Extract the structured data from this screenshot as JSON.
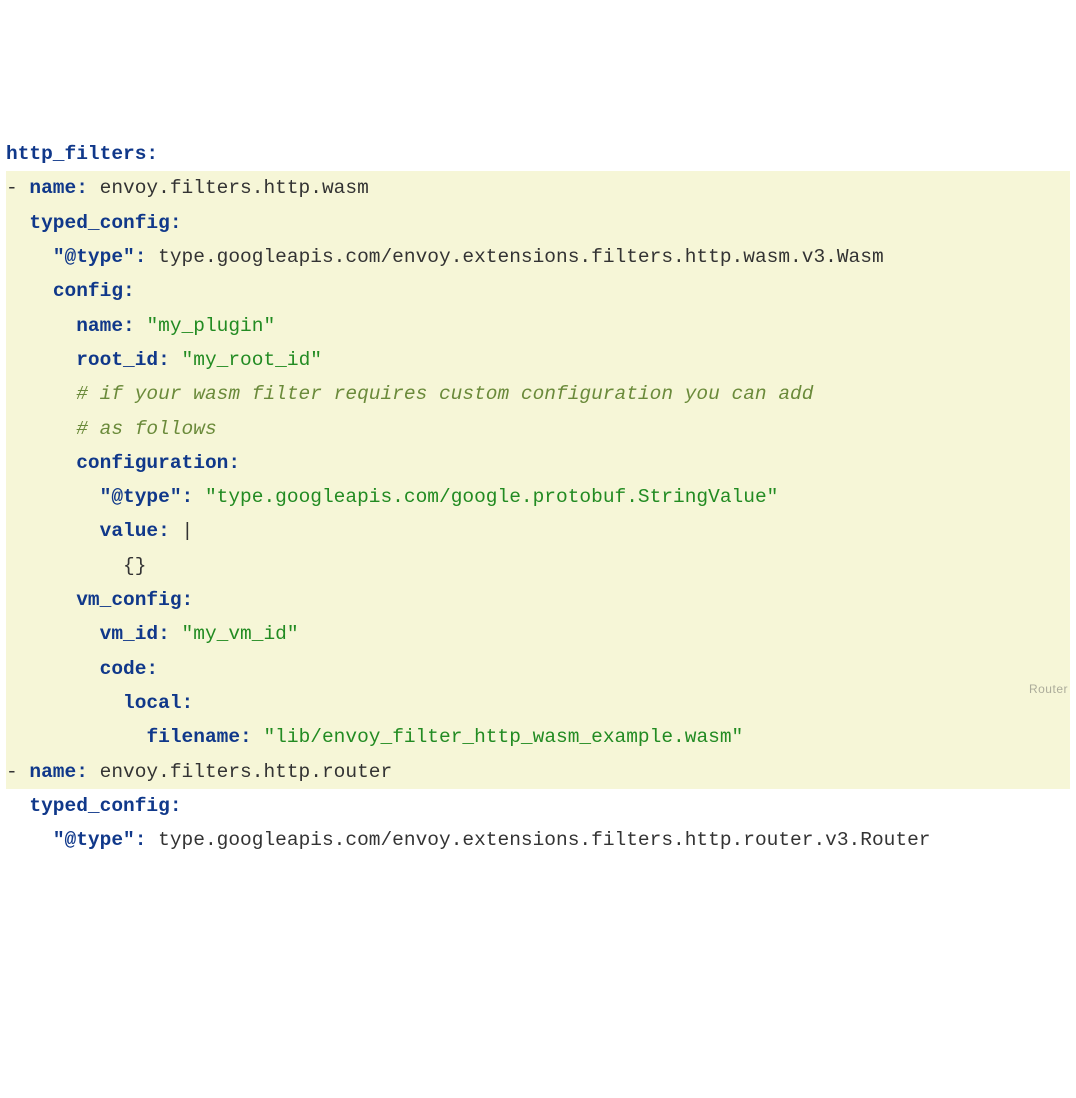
{
  "lines": {
    "l1_key": "http_filters:",
    "l2_dash": "-",
    "l2_key": "name:",
    "l2_val": "envoy.filters.http.wasm",
    "l3_key": "typed_config:",
    "l4_key": "\"@type\":",
    "l4_val": "type.googleapis.com/envoy.extensions.filters.http.wasm.v3.Wasm",
    "l5_key": "config:",
    "l6_key": "name:",
    "l6_val": "\"my_plugin\"",
    "l7_key": "root_id:",
    "l7_val": "\"my_root_id\"",
    "l8_comment": "# if your wasm filter requires custom configuration you can add",
    "l9_comment": "# as follows",
    "l10_key": "configuration:",
    "l11_key": "\"@type\":",
    "l11_val": "\"type.googleapis.com/google.protobuf.StringValue\"",
    "l12_key": "value:",
    "l12_val": "|",
    "l13_val": "{}",
    "l14_key": "vm_config:",
    "l15_key": "vm_id:",
    "l15_val": "\"my_vm_id\"",
    "l16_key": "code:",
    "l17_key": "local:",
    "l18_key": "filename:",
    "l18_val": "\"lib/envoy_filter_http_wasm_example.wasm\"",
    "l19_dash": "-",
    "l19_key": "name:",
    "l19_val": "envoy.filters.http.router",
    "l20_key": "typed_config:",
    "l21_key": "\"@type\":",
    "l21_val": "type.googleapis.com/envoy.extensions.filters.http.router.v3.Router"
  },
  "watermark": "Router"
}
